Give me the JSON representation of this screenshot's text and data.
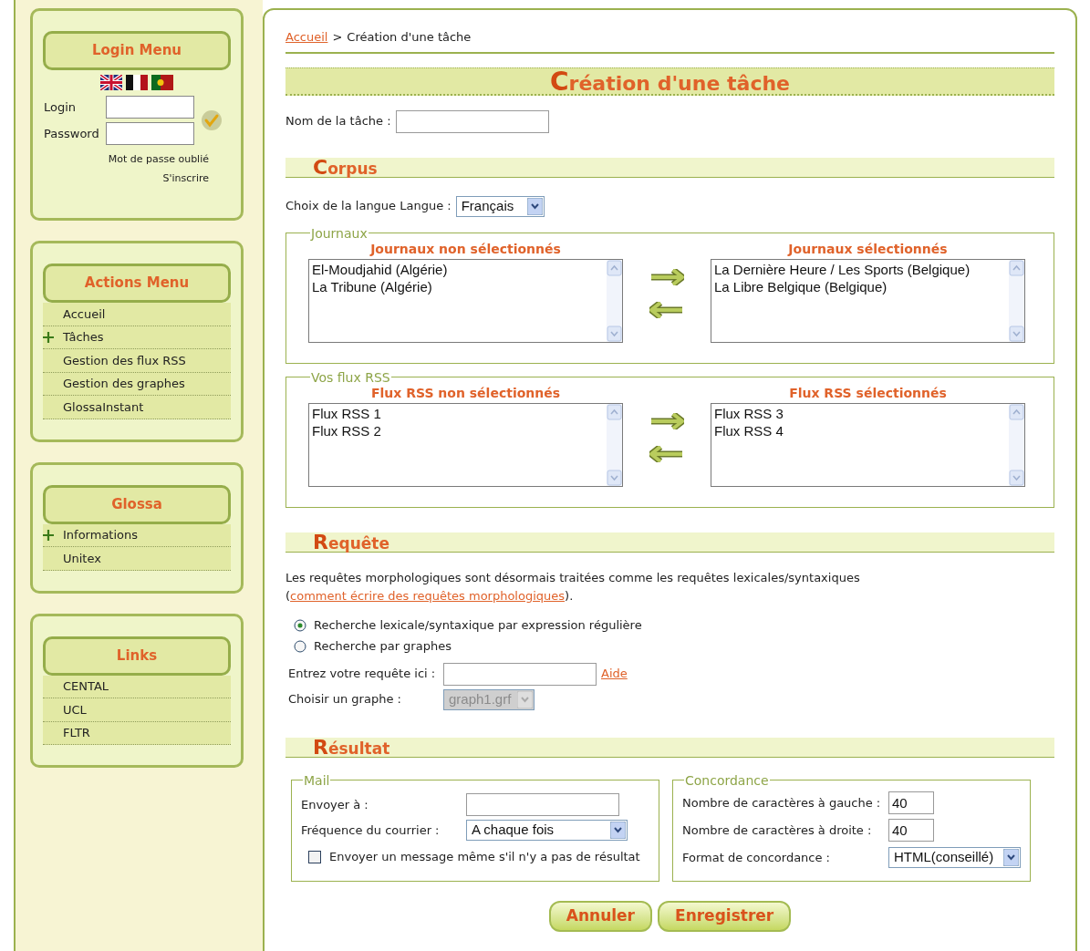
{
  "sidebar": {
    "login_menu": {
      "title": "Login Menu",
      "fields": [
        {
          "label": "Login"
        },
        {
          "label": "Password"
        }
      ],
      "links": [
        "Mot de passe oublié",
        "S'inscrire"
      ]
    },
    "menus": [
      {
        "title": "Actions Menu",
        "items": [
          {
            "label": "Accueil",
            "has_children": false
          },
          {
            "label": "Tâches",
            "has_children": true
          },
          {
            "label": "Gestion des flux RSS",
            "has_children": false
          },
          {
            "label": "Gestion des graphes",
            "has_children": false
          },
          {
            "label": "GlossaInstant",
            "has_children": false
          }
        ]
      },
      {
        "title": "Glossa",
        "items": [
          {
            "label": "Informations",
            "has_children": true
          },
          {
            "label": "Unitex",
            "has_children": false
          }
        ]
      },
      {
        "title": "Links",
        "items": [
          {
            "label": "CENTAL",
            "has_children": false
          },
          {
            "label": "UCL",
            "has_children": false
          },
          {
            "label": "FLTR",
            "has_children": false
          }
        ]
      }
    ]
  },
  "breadcrumb": {
    "link": "Accueil",
    "separator": ">",
    "current": "Création d'une tâche"
  },
  "title": "Création d'une tâche",
  "task_name": {
    "label": "Nom de la tâche :"
  },
  "corpus": {
    "heading": "Corpus",
    "language": {
      "label": "Choix de la langue Langue :",
      "value": "Français"
    },
    "groups": [
      {
        "legend": "Journaux",
        "left": {
          "heading": "Journaux non sélectionnés",
          "items": [
            "El-Moudjahid (Algérie)",
            "La Tribune (Algérie)"
          ]
        },
        "right": {
          "heading": "Journaux sélectionnés",
          "items": [
            "La Dernière Heure / Les Sports (Belgique)",
            "La Libre Belgique (Belgique)"
          ]
        }
      },
      {
        "legend": "Vos flux RSS",
        "left": {
          "heading": "Flux RSS non sélectionnés",
          "items": [
            "Flux RSS 1",
            "Flux RSS 2"
          ]
        },
        "right": {
          "heading": "Flux RSS sélectionnés",
          "items": [
            "Flux RSS 3",
            "Flux RSS 4"
          ]
        }
      }
    ]
  },
  "requete": {
    "heading": "Requête",
    "note": {
      "text": "Les requêtes morphologiques sont désormais traitées comme les requêtes lexicales/syntaxiques (",
      "link": "comment écrire des requêtes morphologiques",
      "after": ")."
    },
    "radios": [
      {
        "label": "Recherche lexicale/syntaxique par expression régulière",
        "selected": true
      },
      {
        "label": "Recherche par graphes",
        "selected": false
      }
    ],
    "query": {
      "label": "Entrez votre requête ici :",
      "link": "Aide"
    },
    "graph": {
      "label": "Choisir un graphe :",
      "value": "graph1.grf",
      "disabled": true
    }
  },
  "resultat": {
    "heading": "Résultat",
    "mail": {
      "legend": "Mail",
      "to_label": "Envoyer à :",
      "frequency": {
        "label": "Fréquence du courrier :",
        "value": "A chaque fois"
      },
      "checkbox": {
        "label": "Envoyer un message même s'il n'y a pas de résultat",
        "checked": false
      }
    },
    "concordance": {
      "legend": "Concordance",
      "fields": [
        {
          "kind": "text",
          "label": "Nombre de caractères à gauche :",
          "value": "40"
        },
        {
          "kind": "text",
          "label": "Nombre de caractères à droite :",
          "value": "40"
        },
        {
          "kind": "select",
          "label": "Format de concordance :",
          "value": "HTML(conseillé)"
        }
      ]
    }
  },
  "buttons": [
    "Annuler",
    "Enregistrer"
  ]
}
